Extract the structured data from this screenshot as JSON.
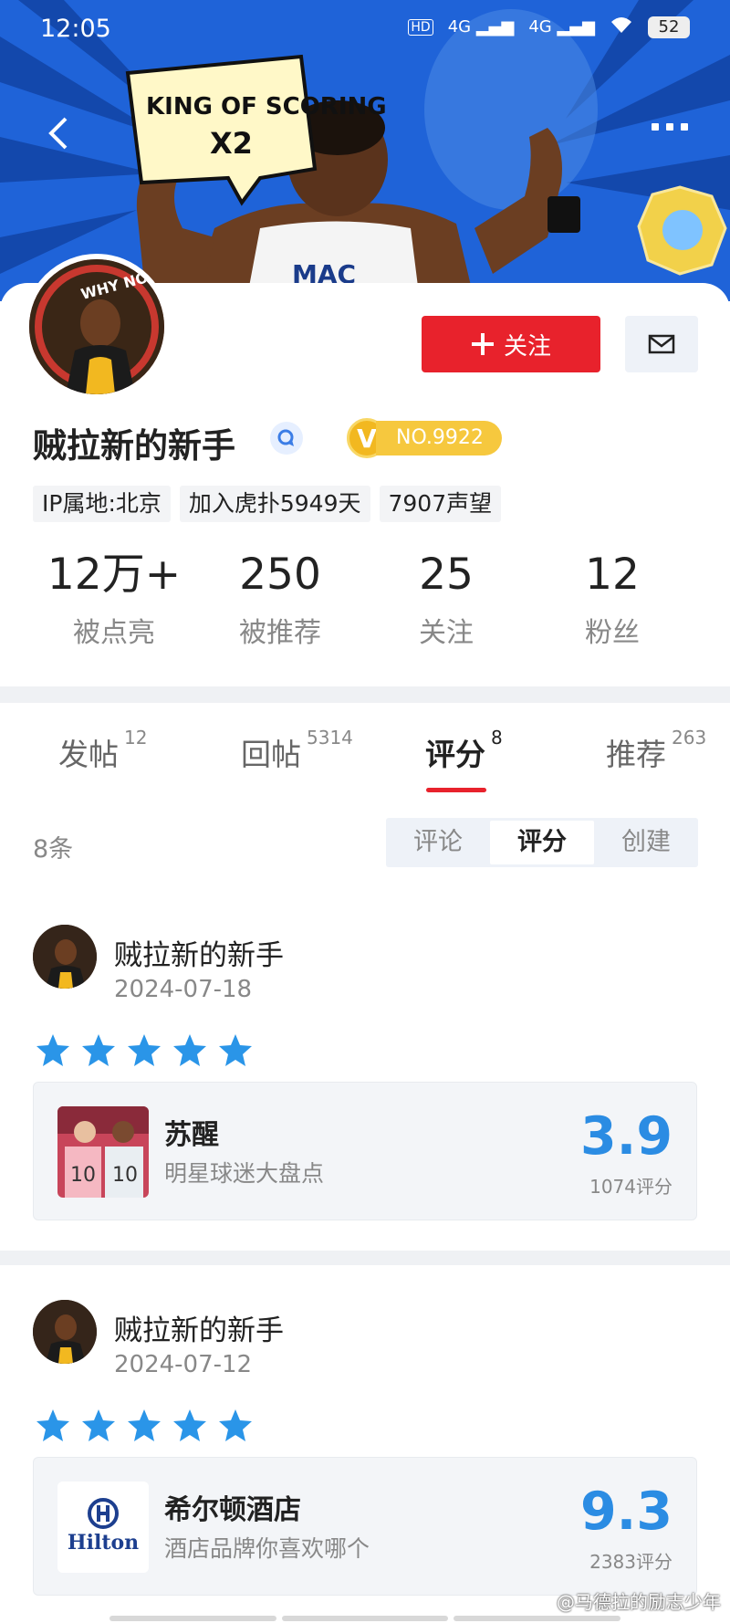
{
  "status_bar": {
    "time": "12:05",
    "signal_1": "4G",
    "signal_2": "4G",
    "hd": "HD",
    "battery": "52"
  },
  "banner": {
    "speech_bubble_line1": "KING OF SCORING",
    "speech_bubble_line2": "X2",
    "avatar_sticker": "WHY NOT?"
  },
  "profile": {
    "follow_label": "关注",
    "username": "贼拉新的新手",
    "vip_level": "NO.9922",
    "tags": [
      "IP属地:北京",
      "加入虎扑5949天",
      "7907声望"
    ],
    "stats": [
      {
        "num": "12万+",
        "label": "被点亮"
      },
      {
        "num": "250",
        "label": "被推荐"
      },
      {
        "num": "25",
        "label": "关注"
      },
      {
        "num": "12",
        "label": "粉丝"
      }
    ]
  },
  "tabs": [
    {
      "label": "发帖",
      "count": "12"
    },
    {
      "label": "回帖",
      "count": "5314"
    },
    {
      "label": "评分",
      "count": "8"
    },
    {
      "label": "推荐",
      "count": "263"
    }
  ],
  "list": {
    "count": "8条",
    "filters": [
      "评论",
      "评分",
      "创建"
    ],
    "active_filter": "评分"
  },
  "items": [
    {
      "user": "贼拉新的新手",
      "date": "2024-07-18",
      "stars": 5,
      "title": "苏醒",
      "subtitle": "明星球迷大盘点",
      "score": "3.9",
      "score_count": "1074评分"
    },
    {
      "user": "贼拉新的新手",
      "date": "2024-07-12",
      "stars": 5,
      "title": "希尔顿酒店",
      "subtitle": "酒店品牌你喜欢哪个",
      "score": "9.3",
      "score_count": "2383评分",
      "thumb_logo": "Hilton"
    }
  ],
  "watermark": "@马德拉的励志少年",
  "colors": {
    "accent_red": "#e8222c",
    "score_blue": "#2b8ce3",
    "star_blue": "#2a95e8",
    "banner_blue": "#1f63d8",
    "vip_gold": "#f6c83e"
  }
}
